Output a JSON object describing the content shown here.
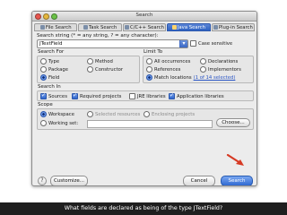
{
  "window": {
    "title": "Search",
    "colors": {
      "accent": "#2f62c2",
      "arrow": "#d63a24",
      "caption_bg": "#1f1f1f"
    }
  },
  "tabs": [
    {
      "label": "File Search",
      "icon": "file-search-icon",
      "active": false
    },
    {
      "label": "Task Search",
      "icon": "task-search-icon",
      "active": false
    },
    {
      "label": "C/C++ Search",
      "icon": "cpp-search-icon",
      "active": false
    },
    {
      "label": "Java Search",
      "icon": "java-search-icon",
      "active": true
    },
    {
      "label": "Plug-in Search",
      "icon": "plugin-search-icon",
      "active": false
    }
  ],
  "search": {
    "label": "Search string (* = any string, ? = any character):",
    "value": "JTextField",
    "case_sensitive": "Case sensitive"
  },
  "search_for": {
    "title": "Search For",
    "options": [
      "Type",
      "Method",
      "Package",
      "Constructor",
      "Field"
    ],
    "selected": "Field"
  },
  "limit_to": {
    "title": "Limit To",
    "options": [
      "All occurrences",
      "Declarations",
      "References",
      "Implementors",
      "Match locations"
    ],
    "selected": "Match locations",
    "match_link": "(1 of 14 selected)"
  },
  "search_in": {
    "title": "Search In",
    "items": [
      {
        "label": "Sources",
        "checked": true
      },
      {
        "label": "Required projects",
        "checked": true
      },
      {
        "label": "JRE libraries",
        "checked": false
      },
      {
        "label": "Application libraries",
        "checked": true
      }
    ]
  },
  "scope": {
    "title": "Scope",
    "workspace": "Workspace",
    "selected_resources": "Selected resources",
    "enclosing_projects": "Enclosing projects",
    "working_set": "Working set:",
    "choose": "Choose...",
    "selected": "Workspace"
  },
  "buttons": {
    "help": "?",
    "customize": "Customize...",
    "cancel": "Cancel",
    "search": "Search"
  },
  "caption": "What fields are declared as being of the type JTextField?"
}
